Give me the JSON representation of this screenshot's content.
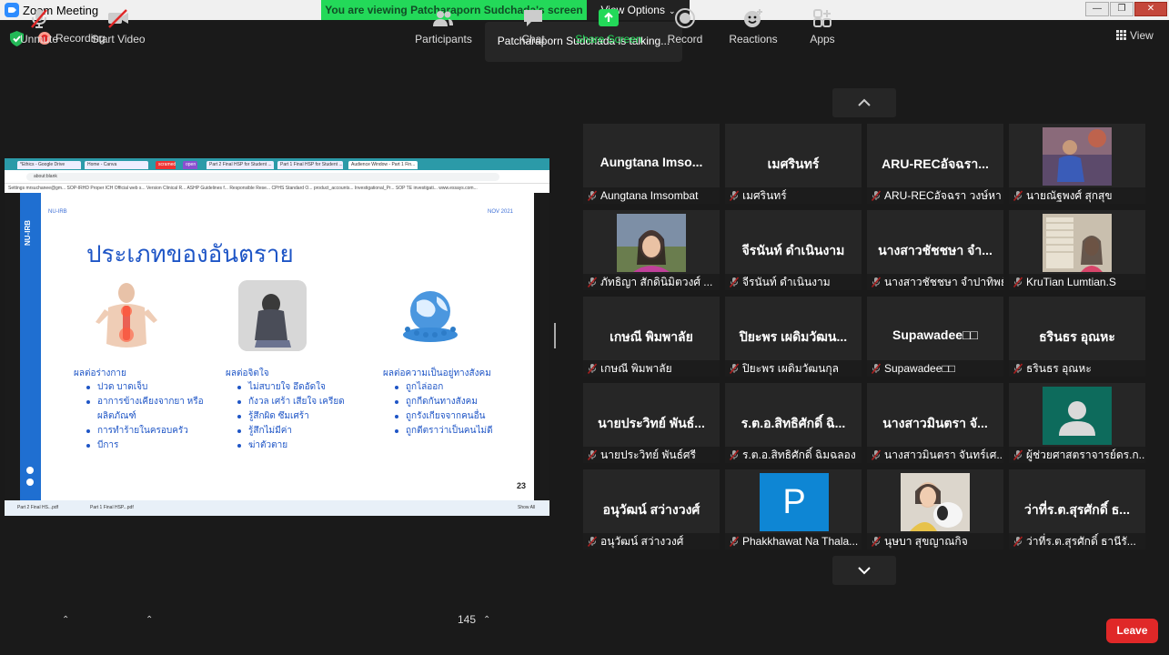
{
  "window": {
    "title": "Zoom Meeting",
    "minimize": "—",
    "maximize": "❐",
    "close": "✕"
  },
  "banner": {
    "viewing": "You are viewing Patcharaporn Sudchada's screen",
    "view_options": "View Options"
  },
  "status": {
    "recording": "Recording",
    "talking": "Patcharaporn Sudchada is talking...",
    "view": "View"
  },
  "shared_screen": {
    "browser_tabs": [
      "*Ethics - Google Drive",
      "Home - Canva",
      "scramed",
      "open",
      "Part 2 Final HSP for Student ...",
      "Part 1 Final HSP for Student ...",
      "Audience Window - Part 1 Fin..."
    ],
    "url": "about:blank",
    "bookmarks": "Settings   mrsuchanee@gm...   SOP-IRHD Proper   ICH Official web s...   Version Clinical R...   ASHP Guidelines f...   Responsible Rese...   CPHS Standard O...   product_accounts...   Investigational_Pr...   SOP TE investigati...   www.essays.com...",
    "slide": {
      "org": "NU-IRB",
      "sidebar_text": "NU-IRB",
      "date": "NOV 2021",
      "title": "ประเภทของอันตราย",
      "page_number": "23",
      "columns": [
        {
          "heading": "ผลต่อร่างกาย",
          "items": [
            "ปวด บาดเจ็บ",
            "อาการข้างเคียงจากยา หรือ ผลิตภัณฑ์",
            "การทำร้ายในครอบครัว",
            "บีการ"
          ]
        },
        {
          "heading": "ผลต่อจิตใจ",
          "items": [
            "ไม่สบายใจ อึดอัดใจ",
            "กังวล เศร้า เสียใจ เครียด",
            "รู้สึกผิด ซึมเศร้า",
            "รู้สึกไม่มีค่า",
            "ฆ่าตัวตาย"
          ]
        },
        {
          "heading": "ผลต่อความเป็นอยู่ทางสังคม",
          "items": [
            "ถูกไล่ออก",
            "ถูกกีดกันทางสังคม",
            "ถูกรังเกียจจากคนอื่น",
            "ถูกตีตราว่าเป็นคนไม่ดี"
          ]
        }
      ]
    },
    "downloads": [
      "Part 2 Final HS...pdf",
      "Part 1 Final HSP...pdf"
    ],
    "show_all": "Show All"
  },
  "participants": [
    {
      "display": "Aungtana Imso...",
      "name": "Aungtana Imsombat",
      "type": "text"
    },
    {
      "display": "เมศรินทร์",
      "name": "เมศรินทร์",
      "type": "text"
    },
    {
      "display": "ARU-RECอัจฉรา...",
      "name": "ARU-RECอัจฉรา วงษ์หา",
      "type": "text"
    },
    {
      "display": "",
      "name": "นายณัฐพงศ์ สุกสุข",
      "type": "photo",
      "photo": "man-outdoors"
    },
    {
      "display": "",
      "name": "ภัทธิญา สักดินิมิตวงศ์ ...",
      "type": "photo",
      "photo": "woman-smiling"
    },
    {
      "display": "จีรนันท์ ดำเนินงาม",
      "name": "จีรนันท์ ดำเนินงาม",
      "type": "text"
    },
    {
      "display": "นางสาวชัชชษา จำ...",
      "name": "นางสาวชัชชษา จำปาทิพย์",
      "type": "text"
    },
    {
      "display": "",
      "name": "KruTian Lumtian.S",
      "type": "photo",
      "photo": "woman-room"
    },
    {
      "display": "เกษณี พิมพาลัย",
      "name": "เกษณี พิมพาลัย",
      "type": "text"
    },
    {
      "display": "ปิยะพร เผดิมวัฒน...",
      "name": "ปิยะพร เผดิมวัฒนกุล",
      "type": "text"
    },
    {
      "display": "Supawadee□□",
      "name": "Supawadee□□",
      "type": "text"
    },
    {
      "display": "ธรินธร อุณหะ",
      "name": "ธรินธร อุณหะ",
      "type": "text"
    },
    {
      "display": "นายประวิทย์ พันธ์...",
      "name": "นายประวิทย์ พันธ์ศรี",
      "type": "text"
    },
    {
      "display": "ร.ต.อ.สิทธิศักดิ์ ฉิ...",
      "name": "ร.ต.อ.สิทธิศักดิ์ ฉิมฉลอง",
      "type": "text"
    },
    {
      "display": "นางสาวมินตรา จั...",
      "name": "นางสาวมินตรา จันทร์เศ...",
      "type": "text"
    },
    {
      "display": "",
      "name": "ผู้ช่วยศาสตราจารย์ดร.ก...",
      "type": "avatar"
    },
    {
      "display": "อนุวัฒน์ สว่างวงศ์",
      "name": "อนุวัฒน์ สว่างวงศ์",
      "type": "text"
    },
    {
      "display": "P",
      "name": "Phakkhawat Na Thala...",
      "type": "letter"
    },
    {
      "display": "",
      "name": "นุษบา สุขญาณกิจ",
      "type": "photo",
      "photo": "woman-dog"
    },
    {
      "display": "ว่าที่ร.ต.สุรศักดิ์ ธ...",
      "name": "ว่าที่ร.ต.สุรศักดิ์ ธานีรั...",
      "type": "text"
    }
  ],
  "toolbar": {
    "unmute": "Unmute",
    "start_video": "Start Video",
    "participants": "Participants",
    "participant_count": "145",
    "chat": "Chat",
    "share_screen": "Share Screen",
    "record": "Record",
    "reactions": "Reactions",
    "apps": "Apps",
    "leave": "Leave"
  },
  "colors": {
    "share_green": "#23d959",
    "leave_red": "#e02828",
    "tile_bg": "#262626",
    "slide_blue": "#1e55c6"
  }
}
